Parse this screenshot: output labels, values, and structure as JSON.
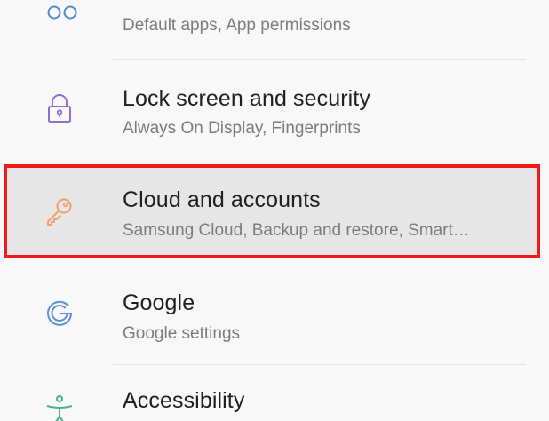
{
  "settings": {
    "items": [
      {
        "title": "",
        "subtitle": "Default apps, App permissions",
        "icon": "apps-icon",
        "icon_color": "#4f8fd1"
      },
      {
        "title": "Lock screen and security",
        "subtitle": "Always On Display, Fingerprints",
        "icon": "lock-icon",
        "icon_color": "#8f6fd0"
      },
      {
        "title": "Cloud and accounts",
        "subtitle": "Samsung Cloud, Backup and restore, Smart…",
        "icon": "key-icon",
        "icon_color": "#f0a06a",
        "highlighted": true
      },
      {
        "title": "Google",
        "subtitle": "Google settings",
        "icon": "google-icon",
        "icon_color": "#5f8fd6"
      },
      {
        "title": "Accessibility",
        "subtitle": "",
        "icon": "accessibility-icon",
        "icon_color": "#48b48a"
      }
    ]
  },
  "colors": {
    "highlight_border": "#ee1c1c",
    "highlight_background": "#e6e6e6",
    "background": "#f8f8f8"
  }
}
